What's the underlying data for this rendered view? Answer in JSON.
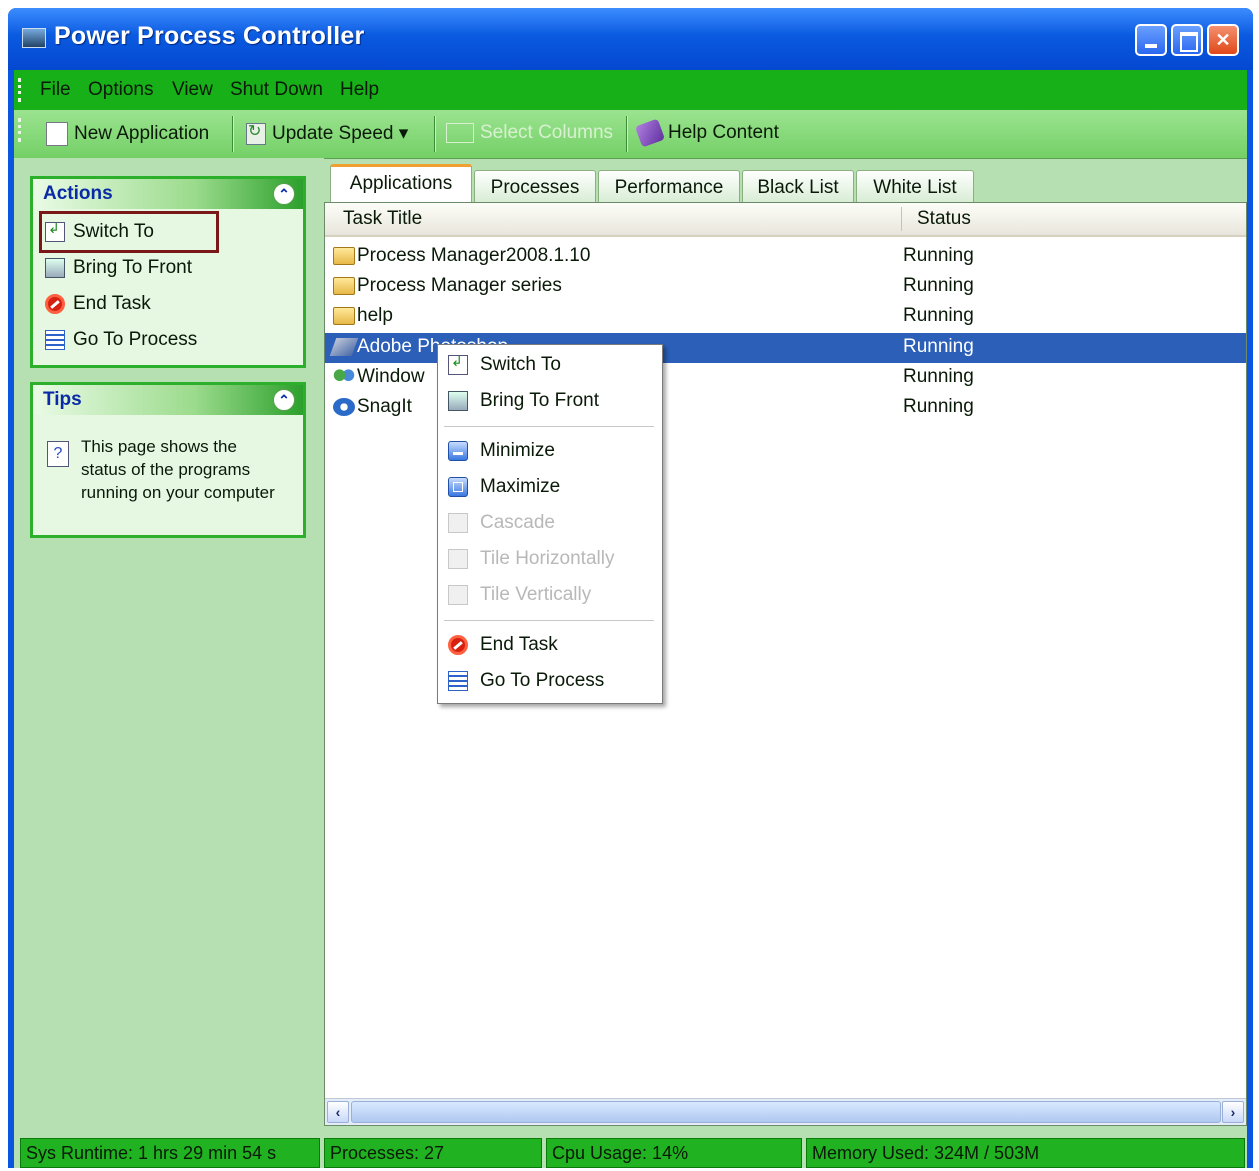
{
  "window": {
    "title": "Power Process Controller"
  },
  "menu": [
    "File",
    "Options",
    "View",
    "Shut Down",
    "Help"
  ],
  "toolbar": {
    "new_application": "New Application",
    "update_speed": "Update Speed ▾",
    "select_columns": "Select Columns",
    "help_content": "Help Content"
  },
  "actions_panel": {
    "title": "Actions",
    "items": [
      "Switch To",
      "Bring To Front",
      "End Task",
      "Go To Process"
    ]
  },
  "tips_panel": {
    "title": "Tips",
    "text": "This page shows the status of the programs running on your computer"
  },
  "tabs": [
    "Applications",
    "Processes",
    "Performance",
    "Black List",
    "White List"
  ],
  "list": {
    "columns": {
      "title": "Task Title",
      "status": "Status"
    },
    "rows": [
      {
        "title": "Process Manager2008.1.10",
        "status": "Running",
        "icon": "folder-icon"
      },
      {
        "title": "Process Manager series",
        "status": "Running",
        "icon": "folder-icon"
      },
      {
        "title": "help",
        "status": "Running",
        "icon": "folder-icon"
      },
      {
        "title": "Adobe Photoshop",
        "status": "Running",
        "icon": "photoshop-icon",
        "selected": true
      },
      {
        "title": "Window",
        "status": "Running",
        "icon": "windows-icon"
      },
      {
        "title": "SnagIt",
        "status": "Running",
        "icon": "snagit-icon"
      }
    ]
  },
  "context_menu": {
    "items": [
      "Switch To",
      "Bring To Front",
      "Minimize",
      "Maximize",
      "Cascade",
      "Tile Horizontally",
      "Tile Vertically",
      "End Task",
      "Go To Process"
    ],
    "disabled": [
      "Cascade",
      "Tile Horizontally",
      "Tile Vertically"
    ]
  },
  "statusbar": {
    "runtime": "Sys Runtime: 1 hrs 29 min 54 s",
    "processes": "Processes: 27",
    "cpu": "Cpu Usage: 14%",
    "memory": "Memory Used: 324M / 503M"
  }
}
